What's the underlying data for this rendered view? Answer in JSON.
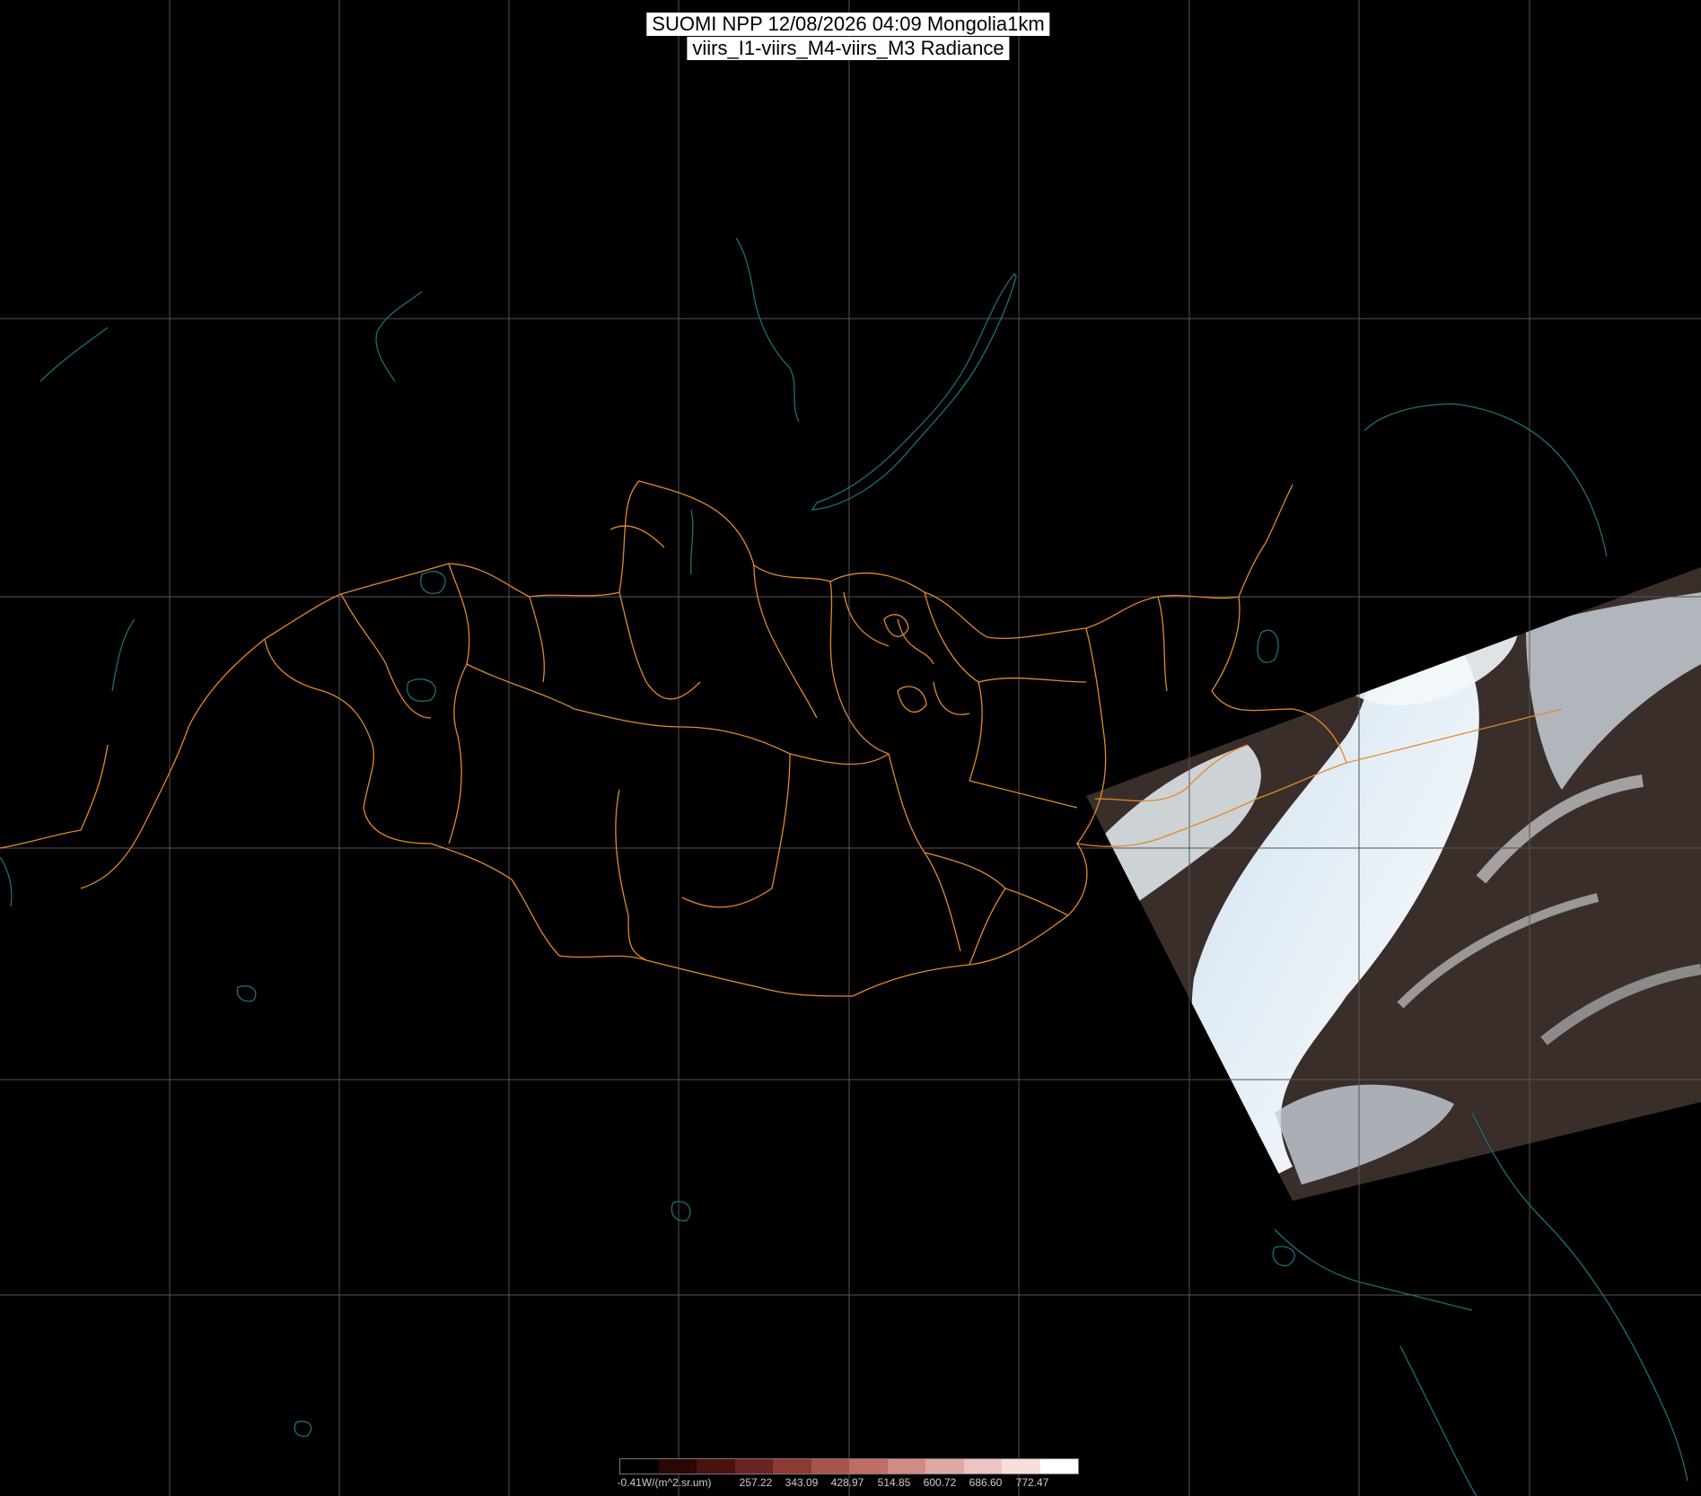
{
  "title": {
    "line1": "SUOMI NPP 12/08/2026 04:09 Mongolia1km",
    "line2": "viirs_I1-viirs_M4-viirs_M3 Radiance"
  },
  "colorbar": {
    "labels": [
      "-0.41W/(m^2.sr.um)",
      "257.22",
      "343.09",
      "428.97",
      "514.85",
      "600.72",
      "686.60",
      "772.47"
    ],
    "colors": [
      "#000000",
      "#2a0604",
      "#4a120e",
      "#6b241f",
      "#8c3a33",
      "#a8544c",
      "#bf6d66",
      "#d18a84",
      "#e0a8a3",
      "#ecc5c2",
      "#f6e0de",
      "#ffffff"
    ]
  },
  "map": {
    "background_color": "#000000",
    "graticule_color": "#555555",
    "border_color": "#e08a2c",
    "coast_color": "#1f6f7a",
    "swath_cloud_color": "#e8f1f8",
    "swath_land_color": "#3a2c28"
  }
}
